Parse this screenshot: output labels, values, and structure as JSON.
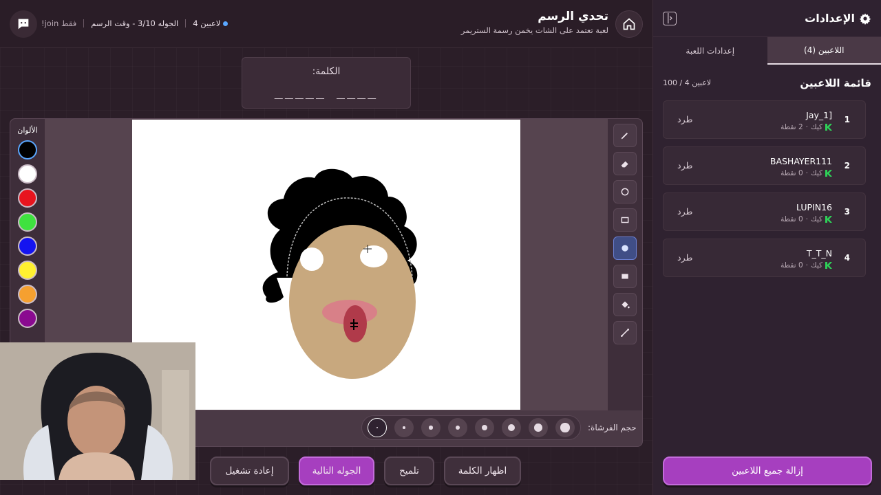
{
  "header": {
    "title": "تحدي الرسم",
    "subtitle": "لعبة تعتمد على الشات يخمن رسمة الستريمر",
    "players_status": "4 لاعبين",
    "round_info": "الجوله 3/10 - وقت الرسم",
    "join_info": "!join فقط",
    "status_dot_color": "#5aa7ff"
  },
  "word": {
    "label": "الكلمة:",
    "blanks": "_____  ____"
  },
  "colors_panel": {
    "title": "الألوان",
    "swatches": [
      "#000000",
      "#ffffff",
      "#e8141e",
      "#3fe13f",
      "#1414f0",
      "#fff030",
      "#f5a030",
      "#8a0a90"
    ]
  },
  "brush": {
    "label": "حجم الفرشاة:",
    "sizes": [
      1,
      2,
      3,
      4,
      5,
      6,
      7,
      8
    ],
    "selected": 1
  },
  "buttons": {
    "show_word": "اظهار الكلمة",
    "hint": "تلميح",
    "next_round": "الجوله التالية",
    "restart": "إعادة تشغيل"
  },
  "sidebar": {
    "title": "الإعدادات",
    "tabs": [
      {
        "label": "اللاعبين (4)",
        "active": true
      },
      {
        "label": "إعدادات اللعبة",
        "active": false
      }
    ],
    "list_title": "قائمة اللاعبين",
    "list_count": "100 / 4 لاعبين",
    "players": [
      {
        "rank": "1",
        "name": "Jay_1]",
        "platform": "كيك",
        "points": "2 نقطة",
        "kick_label": "طرد"
      },
      {
        "rank": "2",
        "name": "BASHAYER111",
        "platform": "كيك",
        "points": "0 نقطة",
        "kick_label": "طرد"
      },
      {
        "rank": "3",
        "name": "LUPIN16",
        "platform": "كيك",
        "points": "0 نقطة",
        "kick_label": "طرد"
      },
      {
        "rank": "4",
        "name": "T_T_N",
        "platform": "كيك",
        "points": "0 نقطة",
        "kick_label": "طرد"
      }
    ],
    "remove_all": "إزالة جميع اللاعبين"
  },
  "accent_color": "#a63fbf"
}
